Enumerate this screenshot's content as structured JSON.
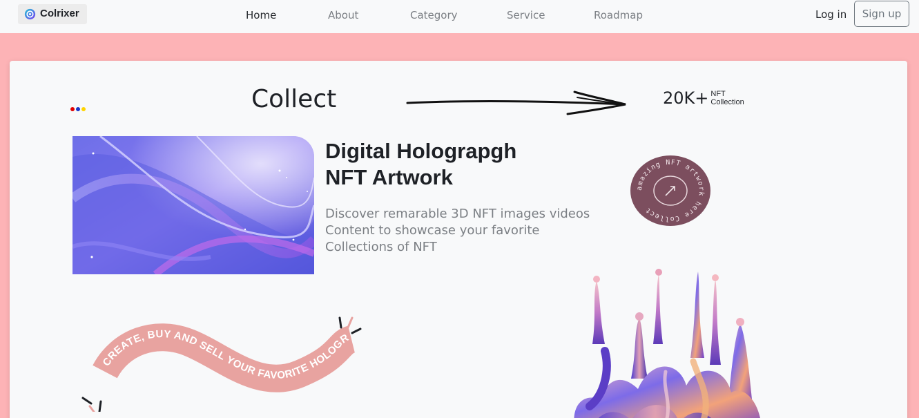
{
  "navbar": {
    "brand": "Colrixer",
    "links": [
      {
        "label": "Home",
        "active": true
      },
      {
        "label": "About",
        "active": false
      },
      {
        "label": "Category",
        "active": false
      },
      {
        "label": "Service",
        "active": false
      },
      {
        "label": "Roadmap",
        "active": false
      }
    ],
    "login_label": "Log in",
    "signup_label": "Sign up"
  },
  "hero": {
    "collect_label": "Collect",
    "stat_value": "20K+",
    "stat_sub_1": "NFT",
    "stat_sub_2": "Collection",
    "heading_line_1": "Digital Holograpgh",
    "heading_line_2": "NFT Artwork",
    "description_lines": [
      "Discover remarable 3D NFT images videos",
      "Content to showcase your favorite",
      "Collections of NFT"
    ],
    "badge_text": "amazing NFT artwork here Collect",
    "banner_text": "CREATE, BUY AND SELL YOUR FAVORITE HOLOGRAPH"
  },
  "colors": {
    "page_background": "#fdb3b6",
    "navbar_background": "#f8f9fa",
    "badge": "#7c4e5e",
    "banner": "#e8a3a0",
    "dots": [
      "#e10000",
      "#1a36c8",
      "#ffd400"
    ]
  },
  "icons": {
    "brand": "brand-logo-icon",
    "arrow": "long-arrow-right-icon",
    "badge_arrow": "arrow-up-right-icon"
  }
}
